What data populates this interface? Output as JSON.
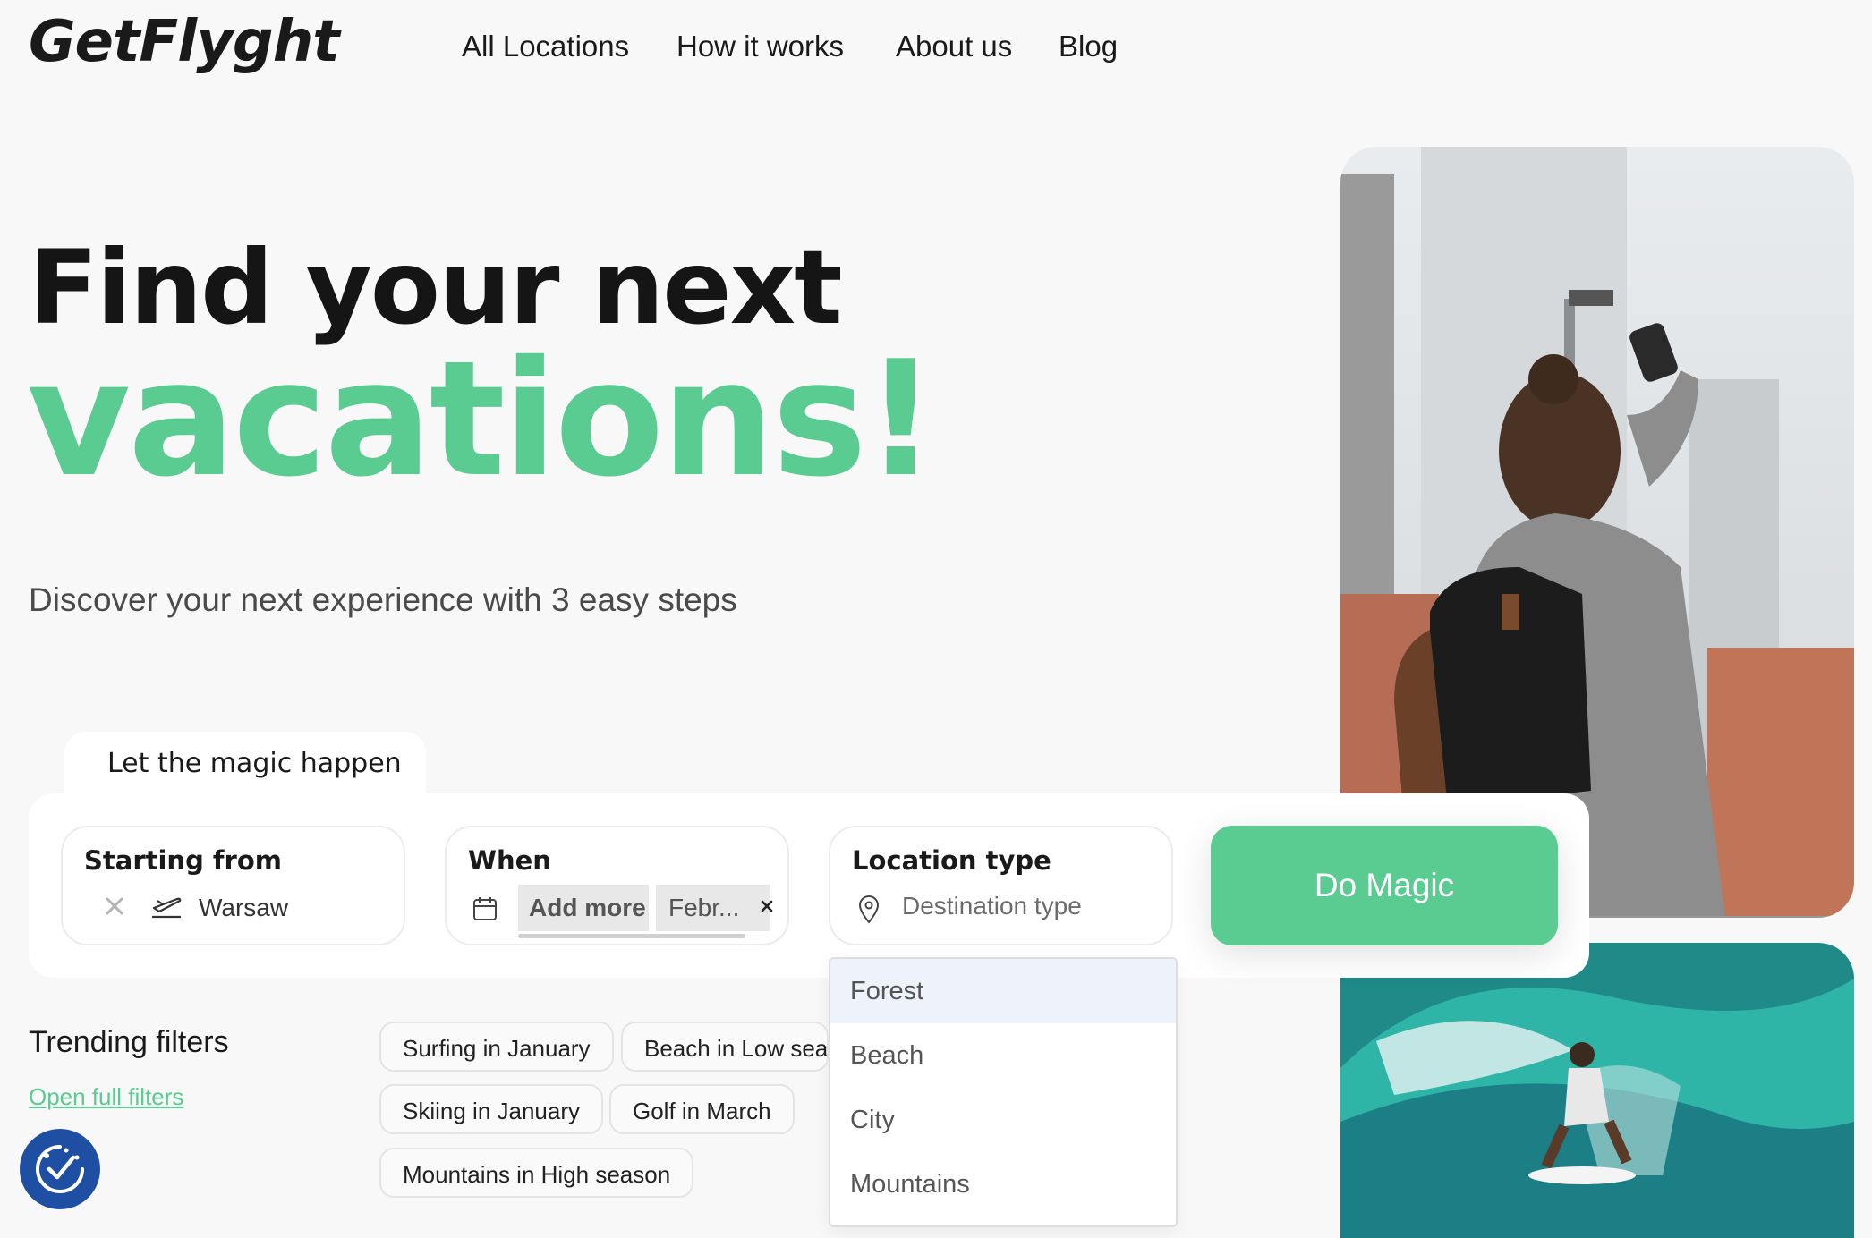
{
  "brand": {
    "logo": "GetFlyght"
  },
  "nav": {
    "items": [
      "All Locations",
      "How it works",
      "About us",
      "Blog"
    ]
  },
  "hero": {
    "line1": "Find your next",
    "line2": "vacations!",
    "subtitle": "Discover your next experience with 3 easy steps"
  },
  "search": {
    "tab_label": "Let the magic happen",
    "starting_from": {
      "label": "Starting from",
      "value": "Warsaw"
    },
    "when": {
      "label": "When",
      "add_more": "Add more",
      "selected": "Febr..."
    },
    "location_type": {
      "label": "Location type",
      "placeholder": "Destination type"
    },
    "submit_label": "Do Magic",
    "dropdown_options": [
      "Forest",
      "Beach",
      "City",
      "Mountains"
    ],
    "dropdown_highlighted": "Forest"
  },
  "trending": {
    "title": "Trending filters",
    "open_link": "Open full filters",
    "tags": [
      "Surfing in January",
      "Beach in Low seas",
      "Skiing in January",
      "Golf in March",
      "Mountains in High season"
    ]
  },
  "colors": {
    "accent": "#5acb91",
    "badge": "#1f4fa3",
    "text": "#1a1a1a"
  },
  "icons": [
    "clear-icon",
    "plane-takeoff-icon",
    "calendar-icon",
    "remove-icon",
    "location-pin-icon",
    "consent-badge-icon"
  ]
}
